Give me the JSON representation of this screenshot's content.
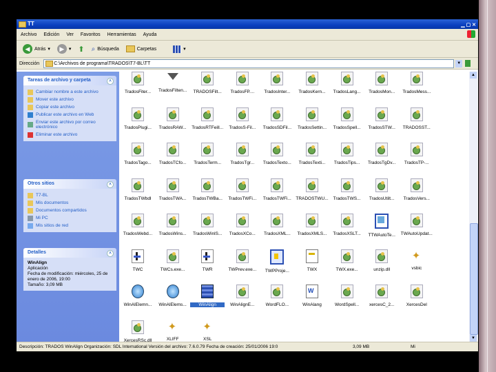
{
  "window": {
    "title": "TT"
  },
  "menu": [
    "Archivo",
    "Edición",
    "Ver",
    "Favoritos",
    "Herramientas",
    "Ayuda"
  ],
  "toolbar": {
    "back_label": "Atrás",
    "search_label": "Búsqueda",
    "folders_label": "Carpetas"
  },
  "address": {
    "label": "Dirección",
    "value": "C:\\Archivos de programa\\TRADOS\\T7-BL\\TT"
  },
  "sidebar": {
    "tasks": {
      "title": "Tareas de archivo y carpeta",
      "items": [
        {
          "label": "Cambiar nombre a este archivo",
          "icon": "rename-icon"
        },
        {
          "label": "Mover este archivo",
          "icon": "move-icon"
        },
        {
          "label": "Copiar este archivo",
          "icon": "copy-icon"
        },
        {
          "label": "Publicar este archivo en Web",
          "icon": "publish-web-icon"
        },
        {
          "label": "Enviar este archivo por correo electrónico",
          "icon": "email-icon"
        },
        {
          "label": "Eliminar este archivo",
          "icon": "delete-icon"
        }
      ]
    },
    "places": {
      "title": "Otros sitios",
      "items": [
        {
          "label": "T7-BL",
          "icon": "folder-icon"
        },
        {
          "label": "Mis documentos",
          "icon": "my-documents-icon"
        },
        {
          "label": "Documentos compartidos",
          "icon": "shared-folder-icon"
        },
        {
          "label": "Mi PC",
          "icon": "my-computer-icon"
        },
        {
          "label": "Mis sitios de red",
          "icon": "network-icon"
        }
      ]
    },
    "details": {
      "title": "Detalles",
      "name": "WinAlign",
      "type": "Aplicación",
      "modified": "Fecha de modificación: miércoles, 25 de enero de 2006, 19:00",
      "size": "Tamaño: 3,09 MB"
    }
  },
  "files": [
    {
      "label": "TradosFiter...",
      "icon": "gear"
    },
    {
      "label": "TradosFilten...",
      "icon": "funnel"
    },
    {
      "label": "TRADOSFilt...",
      "icon": "gear"
    },
    {
      "label": "TradosFP....",
      "icon": "gear"
    },
    {
      "label": "TradosInter...",
      "icon": "gear"
    },
    {
      "label": "TradosKern...",
      "icon": "gear"
    },
    {
      "label": "TradosLang...",
      "icon": "gear"
    },
    {
      "label": "TradosMon...",
      "icon": "gear"
    },
    {
      "label": "TradosMess...",
      "icon": "gear"
    },
    {
      "label": "TradosPlugi...",
      "icon": "gear"
    },
    {
      "label": "TradosRAW...",
      "icon": "gear"
    },
    {
      "label": "TradosRTFeill...",
      "icon": "gear"
    },
    {
      "label": "TradosS-Fil...",
      "icon": "gear"
    },
    {
      "label": "TradosSDFil...",
      "icon": "gear"
    },
    {
      "label": "TradosSettin...",
      "icon": "gear"
    },
    {
      "label": "TradosSpell...",
      "icon": "gear"
    },
    {
      "label": "TradosSTW...",
      "icon": "gear"
    },
    {
      "label": "TRADOSST...",
      "icon": "gear"
    },
    {
      "label": "TradosTago...",
      "icon": "gear"
    },
    {
      "label": "TradosTCfo...",
      "icon": "gear"
    },
    {
      "label": "TradosTerm...",
      "icon": "gear"
    },
    {
      "label": "TradosTgr...",
      "icon": "gear"
    },
    {
      "label": "TradosTexto...",
      "icon": "gear"
    },
    {
      "label": "TradosTexti...",
      "icon": "gear"
    },
    {
      "label": "TradosTips...",
      "icon": "gear"
    },
    {
      "label": "TradosTgDv...",
      "icon": "gear"
    },
    {
      "label": "TradosTP-...",
      "icon": "gear"
    },
    {
      "label": "TradosTWbdl",
      "icon": "gear"
    },
    {
      "label": "TradosTWA...",
      "icon": "gear"
    },
    {
      "label": "TradosTWBa...",
      "icon": "gear"
    },
    {
      "label": "TradosTWFi...",
      "icon": "gear"
    },
    {
      "label": "TradosTWFi...",
      "icon": "gear"
    },
    {
      "label": "TRADOSTWU...",
      "icon": "gear"
    },
    {
      "label": "TradosTWS...",
      "icon": "gear"
    },
    {
      "label": "TradosUtilt...",
      "icon": "gear"
    },
    {
      "label": "TradosVers...",
      "icon": "gear"
    },
    {
      "label": "TradosWebd...",
      "icon": "gear"
    },
    {
      "label": "TradosWins...",
      "icon": "gear"
    },
    {
      "label": "TradosWinlS...",
      "icon": "gear"
    },
    {
      "label": "TradosXCo...",
      "icon": "gear"
    },
    {
      "label": "TradosXML...",
      "icon": "gear"
    },
    {
      "label": "TradosXMLS...",
      "icon": "gear"
    },
    {
      "label": "TradosXSLT...",
      "icon": "gear"
    },
    {
      "label": "TTWAutoTe...",
      "icon": "appblue"
    },
    {
      "label": "TWAutoUpdat...",
      "icon": "gear"
    },
    {
      "label": "TWC",
      "icon": "tool"
    },
    {
      "label": "TWCs.exe...",
      "icon": "gear"
    },
    {
      "label": "TWR",
      "icon": "tool"
    },
    {
      "label": "TWPrev.exe...",
      "icon": "gear"
    },
    {
      "label": "TWPProje...",
      "icon": "blue"
    },
    {
      "label": "TWX",
      "icon": "dll"
    },
    {
      "label": "TWX.exe...",
      "icon": "gear"
    },
    {
      "label": "unzip.dll",
      "icon": "gear"
    },
    {
      "label": "vsbic",
      "icon": "star"
    },
    {
      "label": "WinAlElemn...",
      "icon": "globe"
    },
    {
      "label": "WinAlElems...",
      "icon": "globe"
    },
    {
      "label": "WinAlign",
      "icon": "grid"
    },
    {
      "label": "WinAlignE...",
      "icon": "gear"
    },
    {
      "label": "WordFLO...",
      "icon": "gear"
    },
    {
      "label": "WinAlang",
      "icon": "word"
    },
    {
      "label": "WordSpell...",
      "icon": "gear"
    },
    {
      "label": "xercesC_2...",
      "icon": "gear"
    },
    {
      "label": "XercesDel",
      "icon": "gear"
    },
    {
      "label": "XercesRSc.dll",
      "icon": "gear"
    },
    {
      "label": "XLIFF",
      "icon": "star"
    },
    {
      "label": "XSL",
      "icon": "star"
    }
  ],
  "selected_file": "WinAlign",
  "status": {
    "description": "Descripción: TRADOS WinAlign Organización: SDL International Versión del archivo: 7.6.0.79 Fecha de creación: 25/01/2006 19:0",
    "size": "3,09 MB",
    "location": "Mi equipo"
  }
}
